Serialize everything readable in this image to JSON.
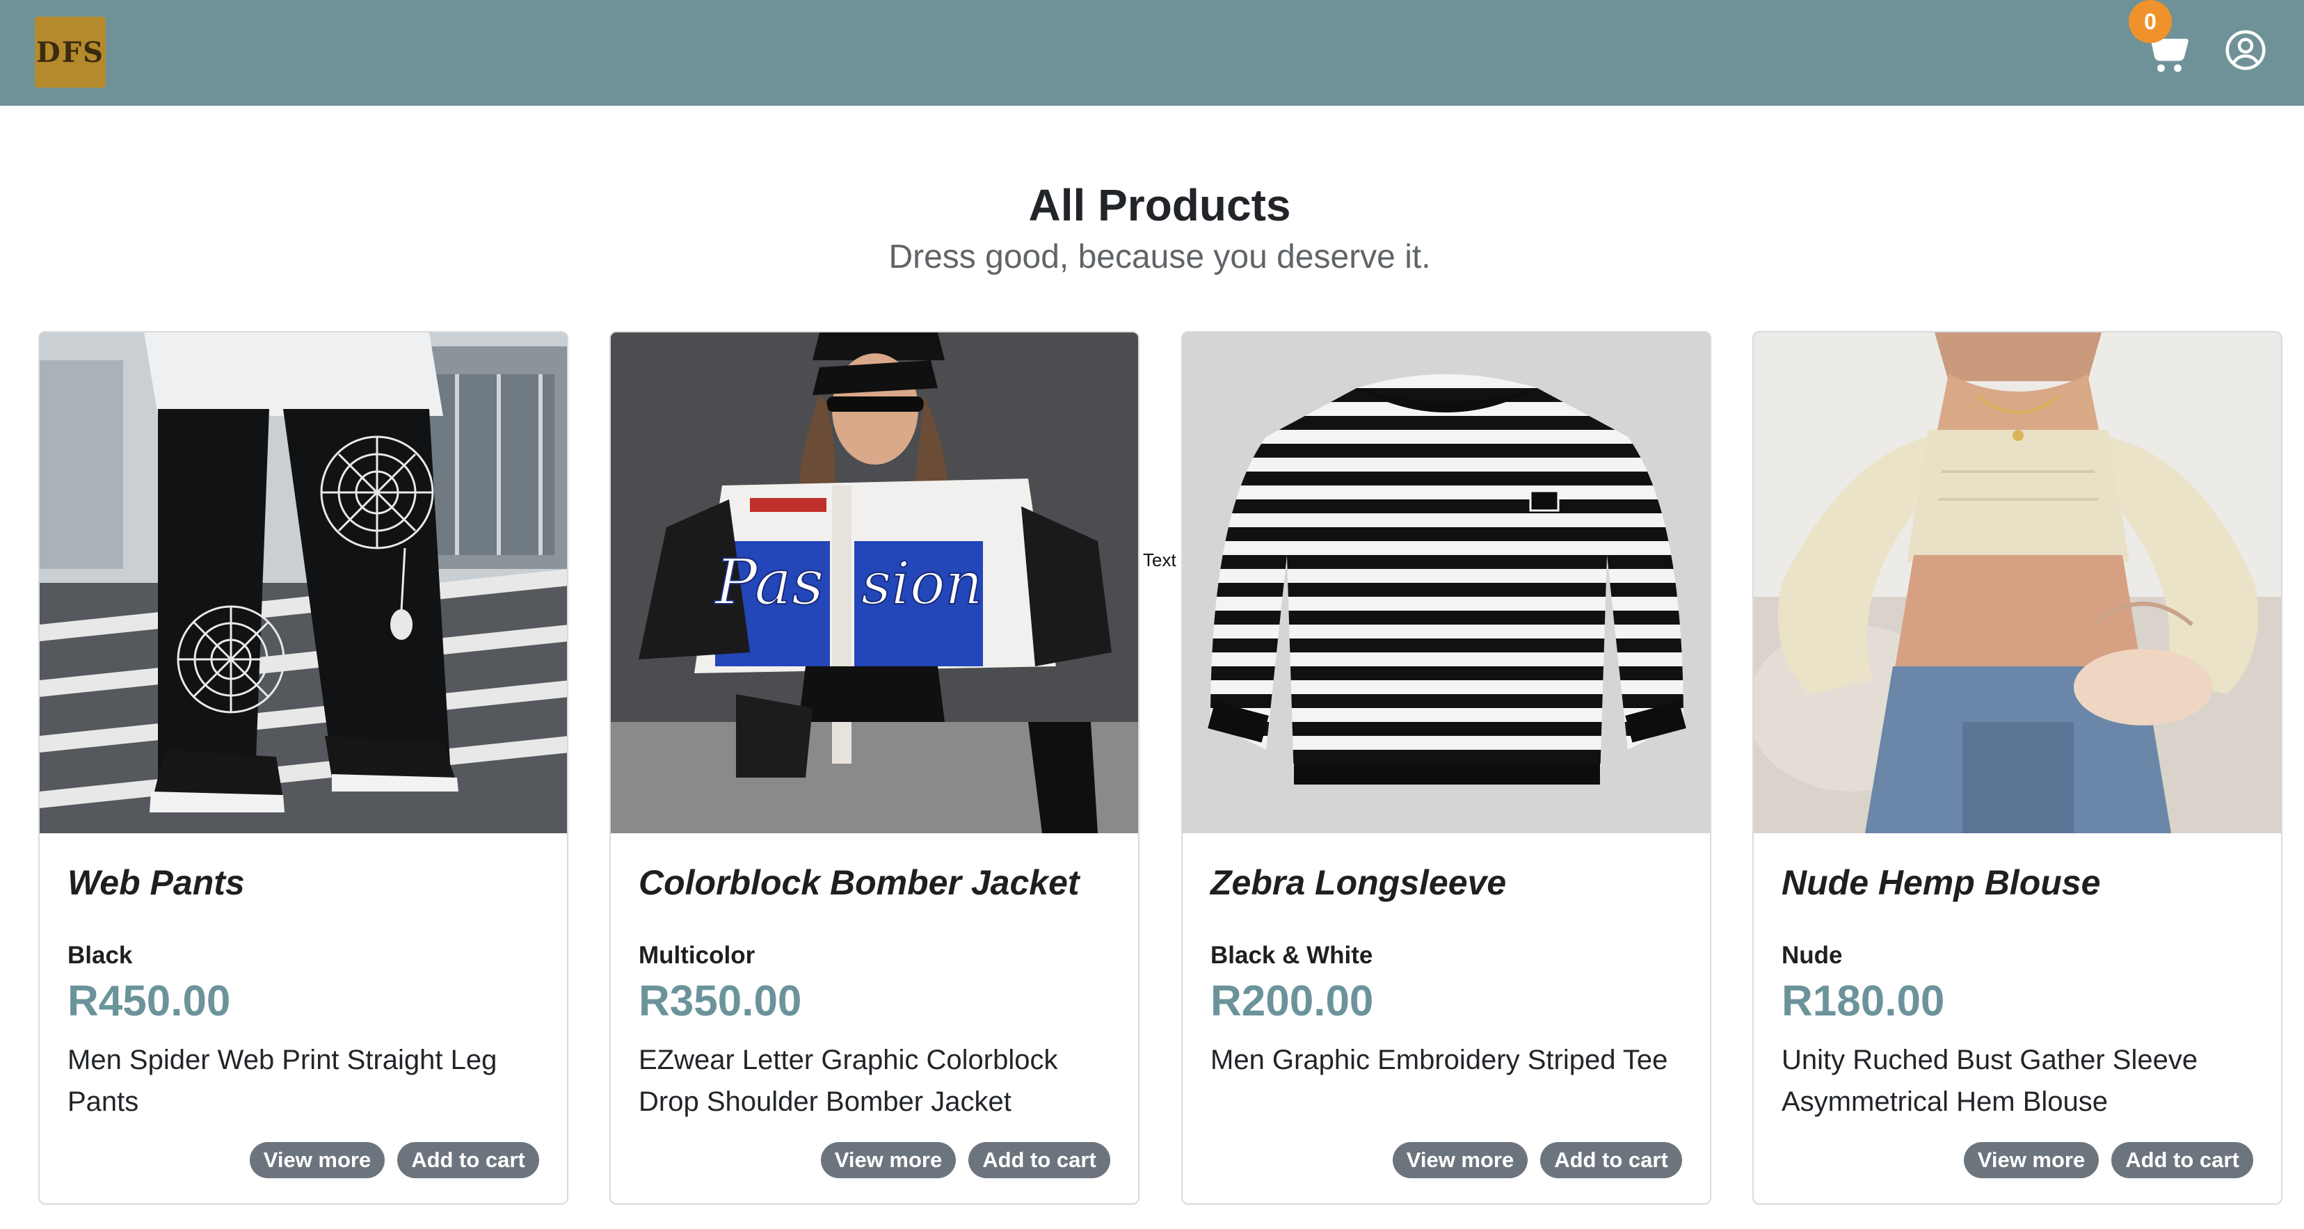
{
  "header": {
    "logo_text": "DFS",
    "cart_count": "0",
    "cart_icon": "shopping-cart-icon",
    "user_icon": "user-circle-icon",
    "bar_color": "#6f9298",
    "badge_color": "#f0922b"
  },
  "main": {
    "title": "All Products",
    "subtitle": "Dress good, because you deserve it.",
    "stray_text": "Text"
  },
  "products": [
    {
      "name": "Web Pants",
      "color": "Black",
      "price": "R450.00",
      "description": "Men Spider Web Print Straight Leg Pants",
      "view_label": "View more",
      "cart_label": "Add to cart"
    },
    {
      "name": "Colorblock Bomber Jacket",
      "color": "Multicolor",
      "price": "R350.00",
      "description": "EZwear Letter Graphic Colorblock Drop Shoulder Bomber Jacket",
      "view_label": "View more",
      "cart_label": "Add to cart"
    },
    {
      "name": "Zebra Longsleeve",
      "color": "Black & White",
      "price": "R200.00",
      "description": "Men Graphic Embroidery Striped Tee",
      "view_label": "View more",
      "cart_label": "Add to cart"
    },
    {
      "name": "Nude Hemp Blouse",
      "color": "Nude",
      "price": "R180.00",
      "description": "Unity Ruched Bust Gather Sleeve Asymmetrical Hem Blouse",
      "view_label": "View more",
      "cart_label": "Add to cart"
    }
  ],
  "colors": {
    "price": "#6b939a",
    "button": "#6c757d"
  }
}
